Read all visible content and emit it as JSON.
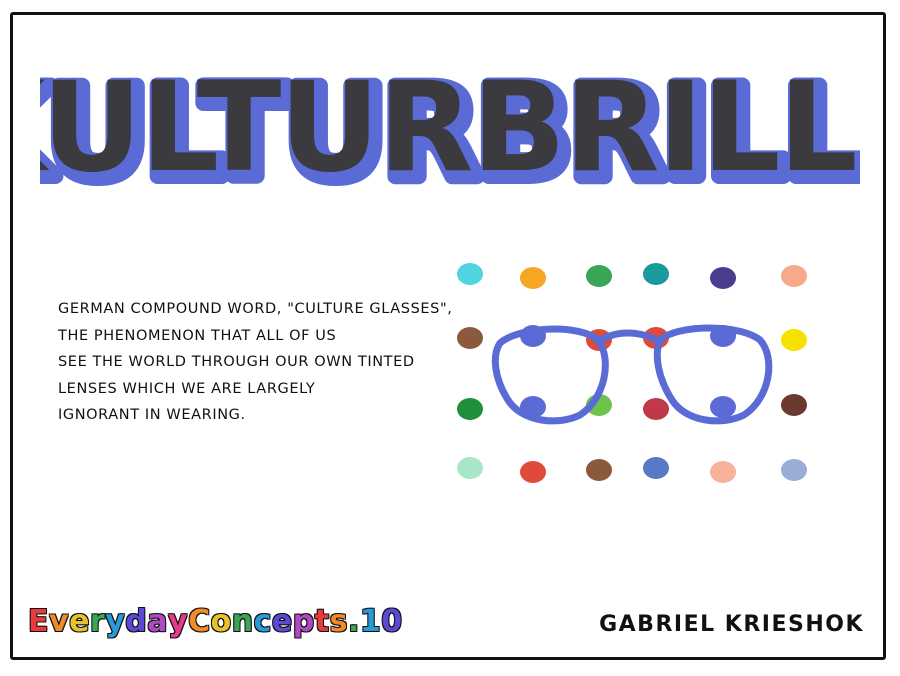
{
  "title": "KULTURBRILLE",
  "definition_lines": [
    "German compound word, \"culture glasses\",",
    "the phenomenon that all of us",
    "see the world through our own tinted",
    "lenses which we are largely",
    "ignorant in wearing."
  ],
  "series_name": "EverydayConcepts.10",
  "author": "Gabriel Krieshok",
  "colors": {
    "title_fill": "#3b3a3f",
    "title_outline": "#5b6bd6",
    "glasses": "#5b6bd6",
    "frame": "#111111"
  },
  "dots": [
    {
      "row": 0,
      "col": 0,
      "color": "#4fd4e0"
    },
    {
      "row": 0,
      "col": 1,
      "color": "#f5a623"
    },
    {
      "row": 0,
      "col": 2,
      "color": "#3aa655"
    },
    {
      "row": 0,
      "col": 3,
      "color": "#1a9a9a"
    },
    {
      "row": 0,
      "col": 4,
      "color": "#4a3d8f"
    },
    {
      "row": 0,
      "col": 5,
      "color": "#f7a98b"
    },
    {
      "row": 1,
      "col": 0,
      "color": "#8b5a3c"
    },
    {
      "row": 1,
      "col": 1,
      "color": "#5b6bd6"
    },
    {
      "row": 1,
      "col": 2,
      "color": "#e04a3a"
    },
    {
      "row": 1,
      "col": 3,
      "color": "#e04a3a"
    },
    {
      "row": 1,
      "col": 4,
      "color": "#5b6bd6"
    },
    {
      "row": 1,
      "col": 5,
      "color": "#f5e000"
    },
    {
      "row": 2,
      "col": 0,
      "color": "#1f8f3a"
    },
    {
      "row": 2,
      "col": 1,
      "color": "#5b6bd6"
    },
    {
      "row": 2,
      "col": 2,
      "color": "#6cc24a"
    },
    {
      "row": 2,
      "col": 3,
      "color": "#c0394b"
    },
    {
      "row": 2,
      "col": 4,
      "color": "#5b6bd6"
    },
    {
      "row": 2,
      "col": 5,
      "color": "#6b3a2e"
    },
    {
      "row": 3,
      "col": 0,
      "color": "#a8e6c8"
    },
    {
      "row": 3,
      "col": 1,
      "color": "#e04a3a"
    },
    {
      "row": 3,
      "col": 2,
      "color": "#8b5a3c"
    },
    {
      "row": 3,
      "col": 3,
      "color": "#5a78c8"
    },
    {
      "row": 3,
      "col": 4,
      "color": "#f7b39a"
    },
    {
      "row": 3,
      "col": 5,
      "color": "#9aacd8"
    }
  ],
  "series_letter_colors": [
    "#e83a3a",
    "#f08a2a",
    "#e8c22a",
    "#3aa655",
    "#2a9ad6",
    "#5b4ad6",
    "#b04ac2",
    "#e83a8a",
    "#f08a2a",
    "#e8c22a",
    "#3aa655",
    "#2a9ad6",
    "#5b4ad6",
    "#b04ac2",
    "#e83a3a",
    "#f08a2a",
    "#3aa655",
    "#2a9ad6",
    "#5b4ad6"
  ]
}
